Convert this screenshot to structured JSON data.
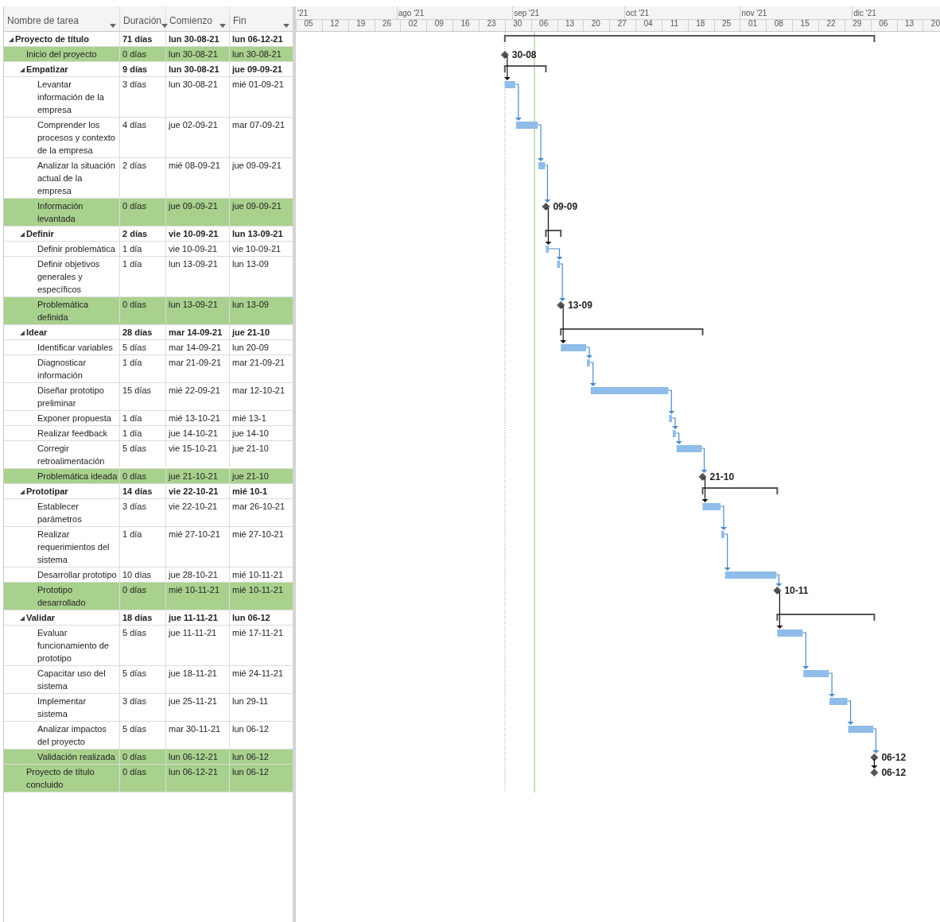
{
  "columns": [
    {
      "label": "Nombre de tarea"
    },
    {
      "label": "Duración"
    },
    {
      "label": "Comienzo"
    },
    {
      "label": "Fin"
    }
  ],
  "timescale": {
    "months": [
      "'21",
      "ago '21",
      "sep '21",
      "oct '21",
      "nov '21",
      "dic '21"
    ],
    "weeks": [
      "05",
      "12",
      "19",
      "26",
      "02",
      "09",
      "16",
      "23",
      "30",
      "06",
      "13",
      "20",
      "27",
      "04",
      "11",
      "18",
      "25",
      "01",
      "08",
      "15",
      "22",
      "29",
      "06",
      "13",
      "20"
    ]
  },
  "tasks": [
    {
      "kind": "summary",
      "name": "Proyecto de título",
      "duration": "71 días",
      "start": "lun 30-08-21",
      "finish": "lun 06-12-21",
      "expanded": true,
      "children": [
        {
          "kind": "milestone",
          "name": "Inicio del proyecto",
          "duration": "0 días",
          "start": "lun 30-08-21",
          "finish": "lun 30-08-21",
          "bar_label": "30-08"
        },
        {
          "kind": "summary",
          "name": "Empatizar",
          "duration": "9 días",
          "start": "lun 30-08-21",
          "finish": "jue 09-09-21",
          "expanded": true,
          "children": [
            {
              "kind": "task",
              "name": "Levantar información de la empresa",
              "duration": "3 días",
              "start": "lun 30-08-21",
              "finish": "mié 01-09-21"
            },
            {
              "kind": "task",
              "name": "Comprender los procesos y contexto de la empresa",
              "duration": "4 días",
              "start": "jue 02-09-21",
              "finish": "mar 07-09-21"
            },
            {
              "kind": "task",
              "name": "Analizar la situación actual de la empresa",
              "duration": "2 días",
              "start": "mié 08-09-21",
              "finish": "jue 09-09-21"
            },
            {
              "kind": "milestone",
              "name": "Información levantada",
              "duration": "0 días",
              "start": "jue 09-09-21",
              "finish": "jue 09-09-21",
              "bar_label": "09-09"
            }
          ]
        },
        {
          "kind": "summary",
          "name": "Definir",
          "duration": "2 días",
          "start": "vie 10-09-21",
          "finish": "lun 13-09-21",
          "expanded": true,
          "children": [
            {
              "kind": "task",
              "name": "Definir problemática",
              "duration": "1 día",
              "start": "vie 10-09-21",
              "finish": "vie 10-09-21"
            },
            {
              "kind": "task",
              "name": "Definir objetivos generales y específicos",
              "duration": "1 día",
              "start": "lun 13-09-21",
              "finish": "lun 13-09"
            },
            {
              "kind": "milestone",
              "name": "Problemática definida",
              "duration": "0 días",
              "start": "lun 13-09-21",
              "finish": "lun 13-09",
              "bar_label": "13-09"
            }
          ]
        },
        {
          "kind": "summary",
          "name": "Idear",
          "duration": "28 días",
          "start": "mar 14-09-21",
          "finish": "jue 21-10",
          "expanded": true,
          "children": [
            {
              "kind": "task",
              "name": "Identificar variables",
              "duration": "5 días",
              "start": "mar 14-09-21",
              "finish": "lun 20-09"
            },
            {
              "kind": "task",
              "name": "Diagnosticar información",
              "duration": "1 día",
              "start": "mar 21-09-21",
              "finish": "mar 21-09-21"
            },
            {
              "kind": "task",
              "name": "Diseñar prototipo preliminar",
              "duration": "15 días",
              "start": "mié 22-09-21",
              "finish": "mar 12-10-21"
            },
            {
              "kind": "task",
              "name": "Exponer propuesta",
              "duration": "1 día",
              "start": "mié 13-10-21",
              "finish": "mié 13-1"
            },
            {
              "kind": "task",
              "name": "Realizar feedback",
              "duration": "1 día",
              "start": "jue 14-10-21",
              "finish": "jue 14-10"
            },
            {
              "kind": "task",
              "name": "Corregir retroalimentación",
              "duration": "5 días",
              "start": "vie 15-10-21",
              "finish": "jue 21-10"
            },
            {
              "kind": "milestone",
              "name": "Problemática ideada",
              "duration": "0 días",
              "start": "jue 21-10-21",
              "finish": "jue 21-10",
              "bar_label": "21-10"
            }
          ]
        },
        {
          "kind": "summary",
          "name": "Prototipar",
          "duration": "14 días",
          "start": "vie 22-10-21",
          "finish": "mié 10-1",
          "expanded": true,
          "children": [
            {
              "kind": "task",
              "name": "Establecer parámetros",
              "duration": "3 días",
              "start": "vie 22-10-21",
              "finish": "mar 26-10-21"
            },
            {
              "kind": "task",
              "name": "Realizar requerimientos del sistema",
              "duration": "1 día",
              "start": "mié 27-10-21",
              "finish": "mié 27-10-21"
            },
            {
              "kind": "task",
              "name": "Desarrollar prototipo",
              "duration": "10 días",
              "start": "jue 28-10-21",
              "finish": "mié 10-11-21"
            },
            {
              "kind": "milestone",
              "name": "Prototipo desarrollado",
              "duration": "0 días",
              "start": "mié 10-11-21",
              "finish": "mié 10-11-21",
              "bar_label": "10-11"
            }
          ]
        },
        {
          "kind": "summary",
          "name": "Validar",
          "duration": "18 días",
          "start": "jue 11-11-21",
          "finish": "lun 06-12",
          "expanded": true,
          "children": [
            {
              "kind": "task",
              "name": "Evaluar funcionamiento de prototipo",
              "duration": "5 días",
              "start": "jue 11-11-21",
              "finish": "mié 17-11-21"
            },
            {
              "kind": "task",
              "name": "Capacitar uso del sistema",
              "duration": "5 días",
              "start": "jue 18-11-21",
              "finish": "mié 24-11-21"
            },
            {
              "kind": "task",
              "name": "Implementar sistema",
              "duration": "3 días",
              "start": "jue 25-11-21",
              "finish": "lun 29-11"
            },
            {
              "kind": "task",
              "name": "Analizar impactos del proyecto",
              "duration": "5 días",
              "start": "mar 30-11-21",
              "finish": "lun 06-12"
            },
            {
              "kind": "milestone",
              "name": "Validación realizada",
              "duration": "0 días",
              "start": "lun 06-12-21",
              "finish": "lun 06-12",
              "bar_label": "06-12"
            }
          ]
        },
        {
          "kind": "milestone",
          "name": "Proyecto de título concluido",
          "duration": "0 días",
          "start": "lun 06-12-21",
          "finish": "lun 06-12",
          "bar_label": "06-12"
        }
      ]
    }
  ]
}
